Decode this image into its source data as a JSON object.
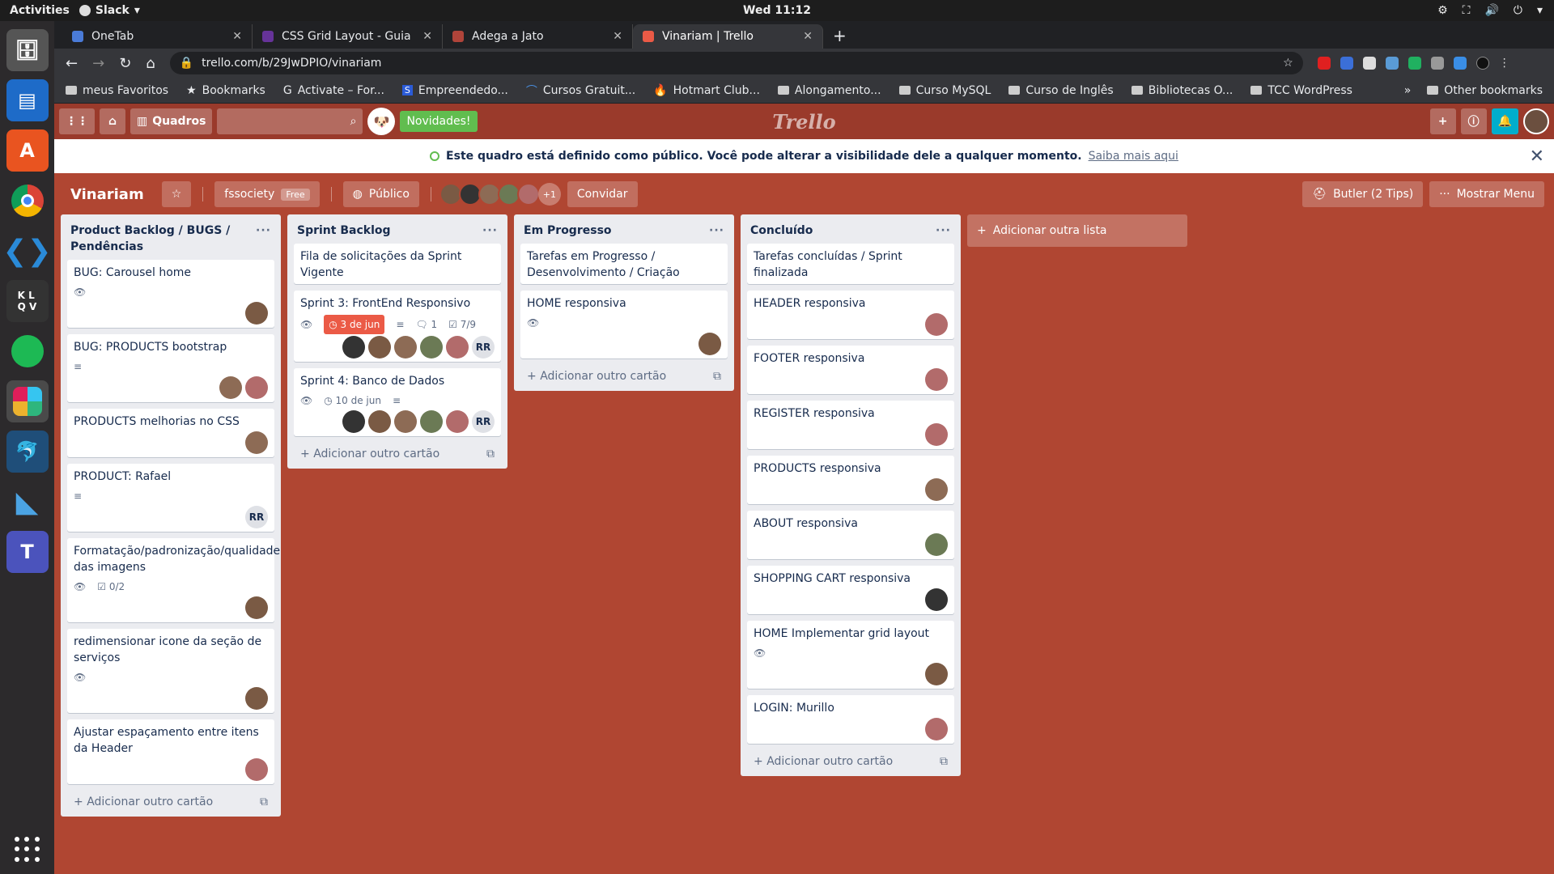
{
  "os": {
    "activities": "Activities",
    "app_name": "Slack",
    "clock": "Wed 11:12"
  },
  "browser": {
    "tabs": [
      {
        "title": "OneTab",
        "active": false,
        "color": "#4a7bd8"
      },
      {
        "title": "CSS Grid Layout - Guia Co",
        "active": false,
        "color": "#663399"
      },
      {
        "title": "Adega a Jato",
        "active": false,
        "color": "#b0443a"
      },
      {
        "title": "Vinariam | Trello",
        "active": true,
        "color": "#eb5a46"
      }
    ],
    "url": "trello.com/b/29JwDPIO/vinariam",
    "bookmarks": [
      "meus Favoritos",
      "Bookmarks",
      "Activate – For...",
      "Empreendedo...",
      "Cursos Gratuit...",
      "Hotmart Club...",
      "Alongamento...",
      "Curso MySQL",
      "Curso de Inglês",
      "Bibliotecas O...",
      "TCC WordPress"
    ],
    "other_bookmarks": "Other bookmarks",
    "overflow": "»"
  },
  "trello_header": {
    "boards_label": "Quadros",
    "novidades": "Novidades!",
    "logo": "Trello"
  },
  "banner": {
    "text": "Este quadro está definido como público. Você pode alterar a visibilidade dele a qualquer momento.",
    "link": "Saiba mais aqui"
  },
  "board": {
    "name": "Vinariam",
    "team": "fssociety",
    "team_badge": "Free",
    "visibility": "Público",
    "members_more": "+1",
    "invite": "Convidar",
    "butler": "Butler (2 Tips)",
    "menu": "Mostrar Menu",
    "add_list": "Adicionar outra lista",
    "add_card": "Adicionar outro cartão"
  },
  "lists": [
    {
      "title": "Product Backlog / BUGS / Pendências",
      "cards": [
        {
          "title": "BUG: Carousel home",
          "badges": {
            "watch": true
          },
          "avatars": [
            "#7a5a44"
          ]
        },
        {
          "title": "BUG: PRODUCTS bootstrap",
          "badges": {
            "desc": true
          },
          "avatars": [
            "#8d6b55",
            "#b26b6b"
          ]
        },
        {
          "title": "PRODUCTS melhorias no CSS",
          "badges": {},
          "avatars": [
            "#8d6b55"
          ]
        },
        {
          "title": "PRODUCT: Rafael",
          "badges": {
            "desc": true
          },
          "avatars": [
            "RR"
          ]
        },
        {
          "title": "Formatação/padronização/qualidade das imagens",
          "badges": {
            "watch": true,
            "checklist": "0/2"
          },
          "avatars": [
            "#7a5a44"
          ]
        },
        {
          "title": "redimensionar icone da seção de serviços",
          "badges": {
            "watch": true
          },
          "avatars": [
            "#7a5a44"
          ]
        },
        {
          "title": "Ajustar espaçamento entre itens da Header",
          "badges": {},
          "avatars": [
            "#b26b6b"
          ]
        }
      ]
    },
    {
      "title": "Sprint Backlog",
      "cards": [
        {
          "title": "Fila de solicitações da Sprint Vigente",
          "badges": {},
          "avatars": []
        },
        {
          "title": "Sprint 3: FrontEnd Responsivo",
          "badges": {
            "watch": true,
            "due": "3 de jun",
            "due_overdue": true,
            "desc": true,
            "comments": "1",
            "checklist": "7/9"
          },
          "avatars": [
            "#333333",
            "#7a5a44",
            "#8d6b55",
            "#6b7a55",
            "#b26b6b",
            "RR"
          ]
        },
        {
          "title": "Sprint 4: Banco de Dados",
          "badges": {
            "watch": true,
            "due": "10 de jun",
            "due_overdue": false,
            "desc": true
          },
          "avatars": [
            "#333333",
            "#7a5a44",
            "#8d6b55",
            "#6b7a55",
            "#b26b6b",
            "RR"
          ]
        }
      ]
    },
    {
      "title": "Em Progresso",
      "cards": [
        {
          "title": "Tarefas em Progresso / Desenvolvimento / Criação",
          "badges": {},
          "avatars": []
        },
        {
          "title": "HOME responsiva",
          "badges": {
            "watch": true
          },
          "avatars": [
            "#7a5a44"
          ]
        }
      ]
    },
    {
      "title": "Concluído",
      "cards": [
        {
          "title": "Tarefas concluídas / Sprint finalizada",
          "badges": {},
          "avatars": []
        },
        {
          "title": "HEADER responsiva",
          "badges": {},
          "avatars": [
            "#b26b6b"
          ]
        },
        {
          "title": "FOOTER responsiva",
          "badges": {},
          "avatars": [
            "#b26b6b"
          ]
        },
        {
          "title": "REGISTER responsiva",
          "badges": {},
          "avatars": [
            "#b26b6b"
          ]
        },
        {
          "title": "PRODUCTS responsiva",
          "badges": {},
          "avatars": [
            "#8d6b55"
          ]
        },
        {
          "title": "ABOUT responsiva",
          "badges": {},
          "avatars": [
            "#6b7a55"
          ]
        },
        {
          "title": "SHOPPING CART responsiva",
          "badges": {},
          "avatars": [
            "#333333"
          ]
        },
        {
          "title": "HOME Implementar grid layout",
          "badges": {
            "watch": true
          },
          "avatars": [
            "#7a5a44"
          ]
        },
        {
          "title": "LOGIN: Murillo",
          "badges": {},
          "avatars": [
            "#b26b6b"
          ]
        }
      ]
    }
  ],
  "colors": {
    "board_bg": "#b04632",
    "header_bg": "#9a3a2b",
    "list_bg": "#ebecf0",
    "due_overdue": "#eb5a46",
    "novidades": "#61bd4f",
    "bell": "#00aecc"
  }
}
